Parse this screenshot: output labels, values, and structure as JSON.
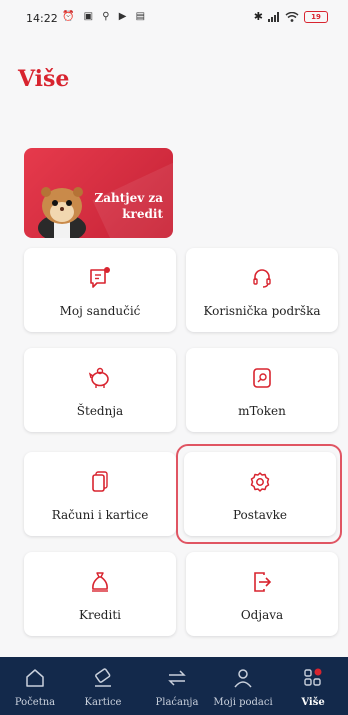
{
  "status_bar": {
    "time": "14:22",
    "left_icons": [
      "alarm-icon",
      "gallery-icon",
      "app-icon",
      "play-icon",
      "message-icon"
    ],
    "right_icons": [
      "bluetooth-icon",
      "signal-icon",
      "wifi-icon"
    ],
    "battery": "19"
  },
  "page": {
    "title": "Više"
  },
  "promo": {
    "text": "Zahtjev za kredit",
    "bg_color": "#d8242f"
  },
  "tiles": [
    {
      "label": "Moj sandučić",
      "icon": "message-inbox-icon",
      "has_badge": true
    },
    {
      "label": "Korisnička podrška",
      "icon": "headset-icon"
    },
    {
      "label": "Štednja",
      "icon": "piggy-bank-icon"
    },
    {
      "label": "mToken",
      "icon": "mtoken-icon"
    },
    {
      "label": "Računi i kartice",
      "icon": "cards-icon"
    },
    {
      "label": "Postavke",
      "icon": "settings-gear-icon",
      "highlighted": true
    },
    {
      "label": "Krediti",
      "icon": "money-bag-icon"
    },
    {
      "label": "Odjava",
      "icon": "logout-icon"
    }
  ],
  "bottom_nav": [
    {
      "label": "Početna",
      "icon": "home-icon"
    },
    {
      "label": "Kartice",
      "icon": "card-icon"
    },
    {
      "label": "Plaćanja",
      "icon": "transfer-icon"
    },
    {
      "label": "Moji podaci",
      "icon": "user-icon"
    },
    {
      "label": "Više",
      "icon": "more-grid-icon",
      "active": true,
      "has_badge": true
    }
  ],
  "colors": {
    "accent": "#d8242f",
    "nav_bg": "#13294b",
    "highlight": "#e05563"
  }
}
